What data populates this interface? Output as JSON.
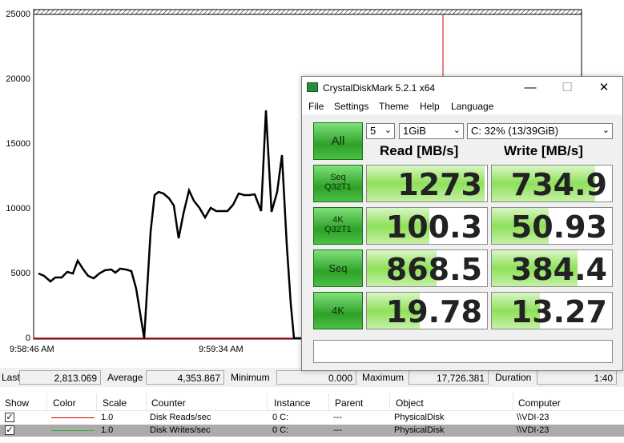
{
  "graph": {
    "y_ticks": [
      "25000",
      "20000",
      "15000",
      "10000",
      "5000",
      "0"
    ],
    "x_ticks": [
      "9:58:46 AM",
      "9:59:34 AM"
    ],
    "colors": {
      "reads_line": "#cc0000",
      "writes_line": "#000000",
      "cursor_line": "#cc0000"
    }
  },
  "stats": {
    "last_label": "Last",
    "last_value": "2,813.069",
    "average_label": "Average",
    "average_value": "4,353.867",
    "minimum_label": "Minimum",
    "minimum_value": "0.000",
    "maximum_label": "Maximum",
    "maximum_value": "17,726.381",
    "duration_label": "Duration",
    "duration_value": "1:40"
  },
  "table": {
    "headers": [
      "Show",
      "Color",
      "Scale",
      "Counter",
      "Instance",
      "Parent",
      "Object",
      "Computer"
    ],
    "rows": [
      {
        "checked": "✓",
        "color": "#cc0000",
        "scale": "1.0",
        "counter": "Disk Reads/sec",
        "instance": "0 C:",
        "parent": "---",
        "object": "PhysicalDisk",
        "computer": "\\\\VDI-23"
      },
      {
        "checked": "✓",
        "color": "#2fb52f",
        "scale": "1.0",
        "counter": "Disk Writes/sec",
        "instance": "0 C:",
        "parent": "---",
        "object": "PhysicalDisk",
        "computer": "\\\\VDI-23"
      }
    ]
  },
  "cdm": {
    "title": "CrystalDiskMark 5.2.1 x64",
    "window_buttons": {
      "minimize": "—",
      "maximize": "☐",
      "close": "✕"
    },
    "menu": [
      "File",
      "Settings",
      "Theme",
      "Help",
      "Language"
    ],
    "all_button": "All",
    "count_select": "5",
    "size_select": "1GiB",
    "drive_select": "C: 32% (13/39GiB)",
    "read_header": "Read [MB/s]",
    "write_header": "Write [MB/s]",
    "rows": [
      {
        "label1": "Seq",
        "label2": "Q32T1",
        "read": "1273",
        "write": "734.9",
        "read_fill": 0.98,
        "write_fill": 0.86
      },
      {
        "label1": "4K",
        "label2": "Q32T1",
        "read": "100.3",
        "write": "50.93",
        "read_fill": 0.52,
        "write_fill": 0.47
      },
      {
        "label1": "Seq",
        "label2": "",
        "read": "868.5",
        "write": "384.4",
        "read_fill": 0.58,
        "write_fill": 0.71
      },
      {
        "label1": "4K",
        "label2": "",
        "read": "19.78",
        "write": "13.27",
        "read_fill": 0.44,
        "write_fill": 0.4
      }
    ],
    "comment": ""
  }
}
